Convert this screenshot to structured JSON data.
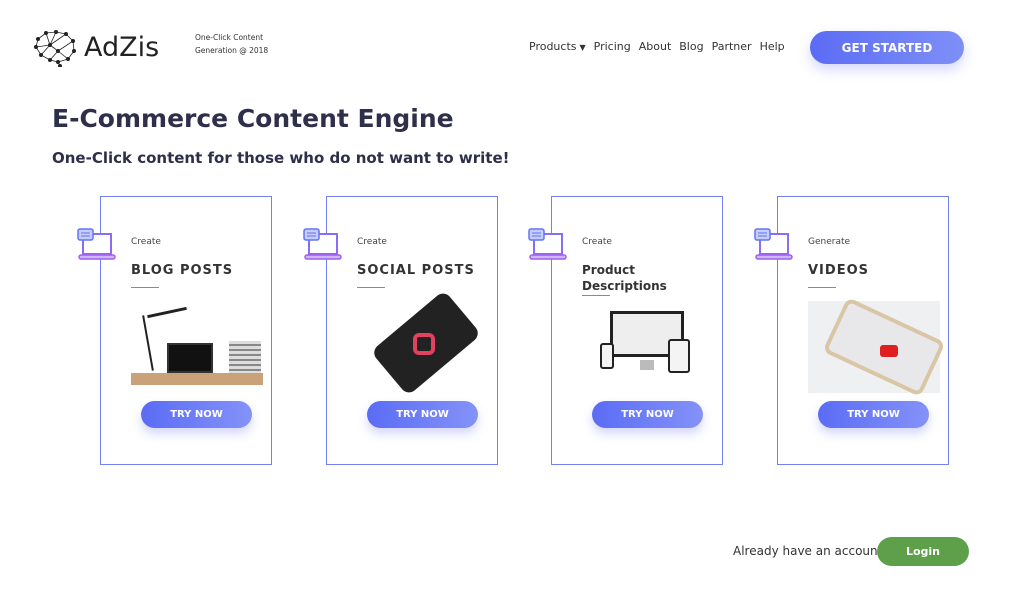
{
  "header": {
    "brand": "AdZis",
    "tagline_1": "One-Click Content",
    "tagline_2": "Generation @ 2018",
    "nav": [
      "Products",
      "Pricing",
      "About",
      "Blog",
      "Partner",
      "Help"
    ],
    "cta": "GET STARTED"
  },
  "hero": {
    "title": "E-Commerce Content Engine",
    "subtitle": "One-Click content for those who do not want to write!"
  },
  "cards": [
    {
      "kicker": "Create",
      "title": "BLOG POSTS",
      "button": "TRY NOW"
    },
    {
      "kicker": "Create",
      "title": "SOCIAL POSTS",
      "button": "TRY NOW"
    },
    {
      "kicker": "Create",
      "title": "Product Descriptions",
      "button": "TRY NOW"
    },
    {
      "kicker": "Generate",
      "title": "VIDEOS",
      "button": "TRY NOW"
    }
  ],
  "footer": {
    "prompt": "Already have an account?",
    "login": "Login"
  },
  "colors": {
    "accent": "#5b6cf5",
    "login": "#5ea04a"
  }
}
